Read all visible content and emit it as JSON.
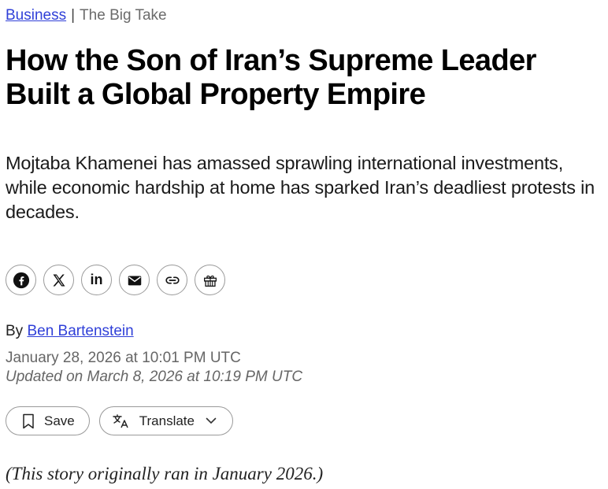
{
  "breadcrumb": {
    "section": "Business",
    "separator": "|",
    "series": "The Big Take"
  },
  "article": {
    "headline": "How the Son of Iran’s Supreme Leader Built a Global Property Empire",
    "dek": "Mojtaba Khamenei has amassed sprawling international investments, while economic hardship at home has sparked Iran’s deadliest protests in decades.",
    "byline_prefix": "By",
    "author": "Ben Bartenstein",
    "published": "January 28, 2026 at 10:01 PM UTC",
    "updated": "Updated on March 8, 2026 at 10:19 PM UTC",
    "note": "(This story originally ran in January 2026.)"
  },
  "share": {
    "icons": [
      "facebook-icon",
      "x-icon",
      "linkedin-icon",
      "email-icon",
      "link-icon",
      "gift-icon"
    ],
    "linkedin_text": "in"
  },
  "actions": {
    "save_label": "Save",
    "translate_label": "Translate"
  },
  "colors": {
    "link": "#2f3fd8",
    "border": "#9a9a9a",
    "muted": "#666666"
  }
}
